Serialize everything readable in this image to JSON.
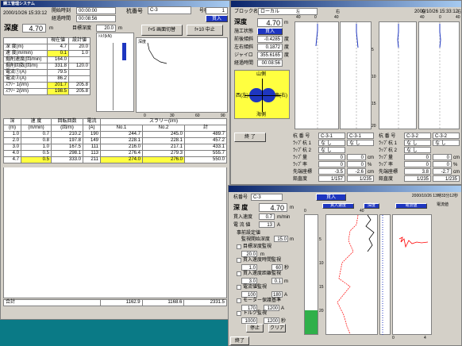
{
  "desktop": {
    "taskbar_color": "#000000"
  },
  "win1": {
    "title": "鋼工管理システム",
    "datetime": "2000/10/26 15:33:12",
    "start_time_label": "開始時刻",
    "start_time": "00:00:00",
    "elapsed_label": "経過時間",
    "elapsed": "00:08:56",
    "pile_no_label": "杭番号",
    "pile_no": "C-3",
    "unit_label": "号機",
    "unit": "1",
    "status": "貫入",
    "depth_label": "深度",
    "depth_value": "4.70",
    "depth_unit": "m",
    "target_depth_label": "目標深度",
    "target_depth_value": "20.0",
    "target_depth_unit": "m",
    "f5_button": "f+5 画面切替",
    "f10_button": "f+10 中止",
    "param_headers": [
      "",
      "現在値",
      "設計値"
    ],
    "params": [
      {
        "label": "深 度(m)",
        "current": "4.7",
        "design": "20.0",
        "hl": false
      },
      {
        "label": "速 度(m/min)",
        "current": "0.1",
        "design": "1.0",
        "hl": true
      },
      {
        "label": "掘削速度(回/min)",
        "current": "164.0",
        "design": "",
        "hl": false
      },
      {
        "label": "掘削回数(回/m)",
        "current": "331.8",
        "design": "120.0",
        "hl": false
      },
      {
        "label": "電流①(A)",
        "current": "79.5",
        "design": "",
        "hl": false
      },
      {
        "label": "電流②(A)",
        "current": "86.2",
        "design": "",
        "hl": false
      },
      {
        "label": "ｽﾗﾘｰ 1(l/m)",
        "current": "201.7",
        "design": "205.8",
        "hl": true
      },
      {
        "label": "ｽﾗﾘｰ 2(l/m)",
        "current": "198.5",
        "design": "205.8",
        "hl": true
      }
    ],
    "mini_chart_label": "ﾄﾙｸ(kN)",
    "chart2_label": "深度",
    "chart2_x_ticks": [
      "0",
      "30",
      "60",
      "90"
    ],
    "table_headers": [
      "深",
      "速 度",
      "回転回数",
      "電流",
      "スラリー(l/m)",
      "",
      ""
    ],
    "table_units": [
      "(m)",
      "(m/min)",
      "(回/m)",
      "(A)",
      "No.1",
      "No.2",
      "計"
    ],
    "rows": [
      [
        "1.0",
        "0.7",
        "210.2",
        "190",
        "244.7",
        "245.0",
        "489.7"
      ],
      [
        "2.0",
        "0.8",
        "197.8",
        "149",
        "228.1",
        "228.1",
        "457.2"
      ],
      [
        "3.0",
        "1.0",
        "167.5",
        "111",
        "216.0",
        "217.1",
        "433.1"
      ],
      [
        "4.0",
        "0.5",
        "298.1",
        "113",
        "276.4",
        "279.3",
        "555.7"
      ],
      [
        "4.7",
        "0.5",
        "333.0",
        "211",
        "274.0",
        "276.0",
        "550.0"
      ]
    ],
    "total_label": "合計",
    "totals": [
      "1162.9",
      "1168.6",
      "2331.5"
    ]
  },
  "win2": {
    "block_label": "ブロック名",
    "block": "ローカル",
    "datetime": "2000/10/26 15:33:12",
    "depth_label": "深度",
    "depth_value": "4.70",
    "depth_unit": "m",
    "status_label": "施工状態",
    "status": "貫入",
    "incl1_label": "前後傾斜",
    "incl1": "-0.4285",
    "incl1_unit": "度",
    "incl2_label": "左右傾斜",
    "incl2": "0.1872",
    "incl2_unit": "度",
    "gyro_label": "ジャイロ",
    "gyro": "355.6165",
    "gyro_unit": "度",
    "elapsed_label": "経過時間",
    "elapsed": "00:08:56",
    "compass_n": "山側",
    "compass_s": "海側",
    "compass_w": "西(左)",
    "compass_e": "東(右)",
    "strip_header_l": "左",
    "strip_header_r": "右",
    "strip_ticks": [
      "40",
      "20",
      "0",
      "20",
      "40"
    ],
    "depth_ticks": [
      "5",
      "10",
      "15",
      "20"
    ],
    "end_button": "終 了",
    "info_left": {
      "pile_label": "杭 番 号",
      "pile1": "C-3-1",
      "pile2": "C-3-1",
      "lap1_label": "ﾗｯﾌﾟ杭 1",
      "lap1a": "な し",
      "lap1b": "な し",
      "lap2_label": "ﾗｯﾌﾟ杭 2",
      "lap2": "な し",
      "lapq_label": "ﾗｯﾌﾟ量",
      "lapq1": "0",
      "lapq2": "0",
      "lapq_unit": "cm",
      "lapr_label": "ﾗｯﾌﾟ率",
      "lapr1": "0",
      "lapr2": "0",
      "lapr_unit": "%",
      "tip_label": "先端座標",
      "tip1": "-3.5",
      "tip2": "-2.6",
      "tip_unit": "cm",
      "rate_label": "鉛直度",
      "rate1": "1/157",
      "rate2": "1/235"
    },
    "info_right": {
      "pile_label": "杭 番 号",
      "pile1": "C-3-2",
      "pile2": "C-3-2",
      "lap1_label": "ﾗｯﾌﾟ杭 1",
      "lap1a": "な し",
      "lap1b": "な し",
      "lap2_label": "ﾗｯﾌﾟ杭 2",
      "lap2": "な し",
      "lapq_label": "ﾗｯﾌﾟ量",
      "lapq1": "0",
      "lapq2": "0",
      "lapq_unit": "cm",
      "lapr_label": "ﾗｯﾌﾟ率",
      "lapr1": "0",
      "lapr2": "0",
      "lapr_unit": "%",
      "tip_label": "先端座標",
      "tip1": "3.8",
      "tip2": "-2.7",
      "tip_unit": "cm",
      "rate_label": "鉛直度",
      "rate1": "1/235",
      "rate2": "1/235"
    }
  },
  "win3": {
    "pile_label": "杭番号",
    "pile": "C-3",
    "status": "貫入",
    "datetime": "2000/10/26 13時33分12秒",
    "depth_label": "深 度",
    "depth_value": "4.70",
    "depth_unit": "m",
    "speed_label": "貫入速度",
    "speed": "0.7",
    "speed_unit": "m/min",
    "current_label": "電 流 値",
    "current": "13",
    "current_unit": "A",
    "settings_title": "事前設定値",
    "sett_time_label": "監視開始深度",
    "sett_time": "15.0",
    "sett_time_unit": "m",
    "checks": [
      {
        "label": "目標深度監視",
        "a": "20.0",
        "b": "",
        "unit": "m"
      },
      {
        "label": "貫入速度時間監視",
        "a": "1.0",
        "b": "60",
        "unit": "秒"
      },
      {
        "label": "貫入速度距離監視",
        "a": "3.0",
        "b": "0.1",
        "unit": "m"
      },
      {
        "label": "電流値監視",
        "a": "100",
        "b": "180",
        "unit": "A"
      },
      {
        "label": "モーター保護基準",
        "a": "170",
        "b": "1200",
        "unit": "A"
      },
      {
        "label": "トルク監視",
        "a": "1000",
        "b": "1200",
        "unit": "秒"
      }
    ],
    "stop_button": "停止",
    "clear_button": "クリア",
    "end_button": "終了",
    "graph_tabs": [
      "貫入速度",
      "深度",
      "電流値"
    ],
    "graph_labels": [
      "電流値",
      "深度",
      "速度"
    ],
    "left_axis": [
      "5",
      "10",
      "15",
      "20"
    ],
    "bottom_axis": [
      "0",
      "10",
      "20",
      "30",
      "40"
    ],
    "right_axis": [
      "0",
      "1",
      "2",
      "3",
      "4"
    ],
    "green_color": "#2fb04a",
    "red_color": "#ff0000"
  }
}
